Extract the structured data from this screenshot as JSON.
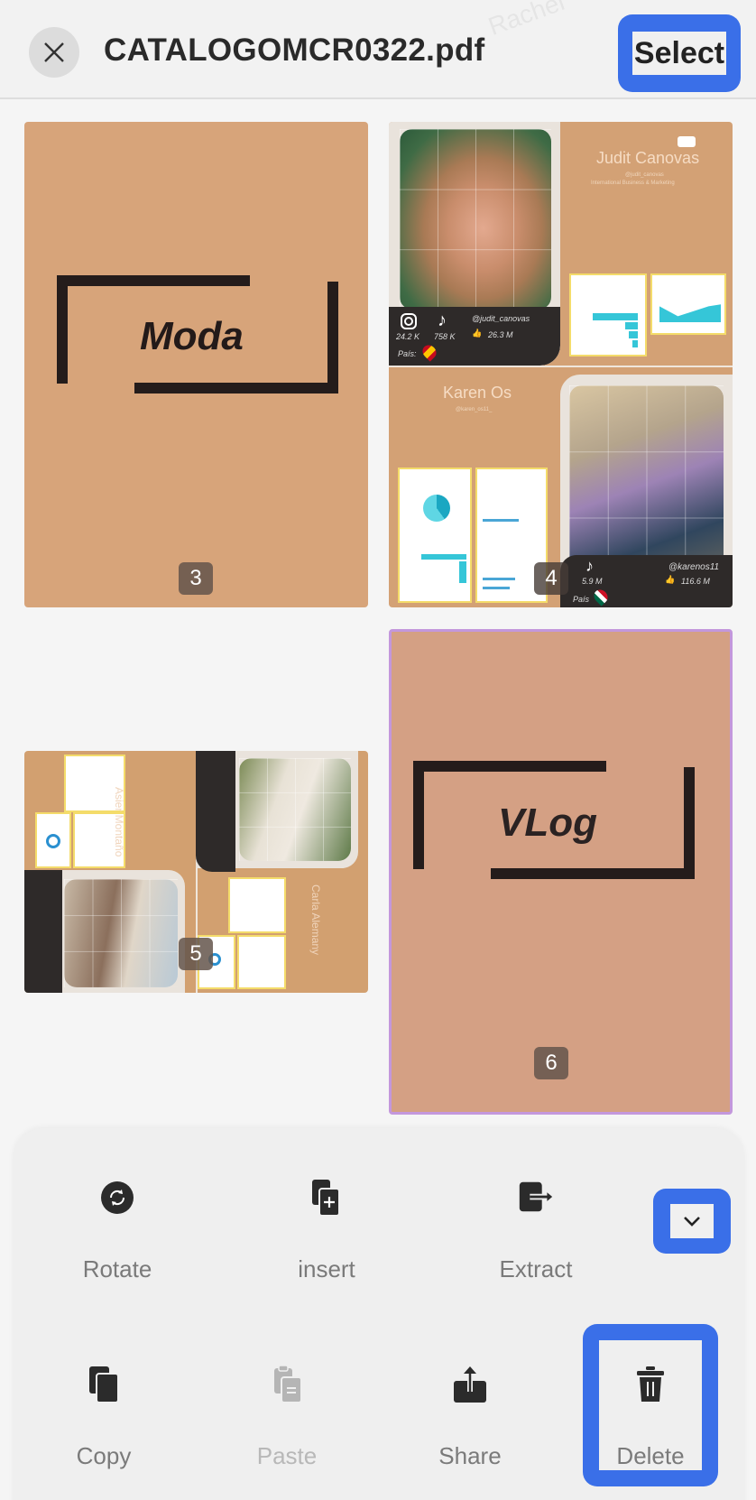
{
  "header": {
    "title": "CATALOGOMCR0322.pdf",
    "select_label": "Select"
  },
  "pages": [
    {
      "number": "3",
      "title": "Moda",
      "selected": false
    },
    {
      "number": "4",
      "selected": false,
      "profiles": [
        {
          "name": "Judit Canovas",
          "handle": "@judit_canovas",
          "subtitle": "International Business & Marketing",
          "instagram_followers": "24.2 K",
          "tiktok_followers": "758 K",
          "likes": "26.3 M",
          "country_label": "País:"
        },
        {
          "name": "Karen Os",
          "handle": "@karen_os11_",
          "tiktok_handle": "@karenos11",
          "tiktok_followers": "5.9 M",
          "likes": "116.6 M",
          "country_label": "País"
        }
      ]
    },
    {
      "number": "5",
      "selected": false,
      "profiles": [
        {
          "name": "Asier Montaño"
        },
        {
          "name": "Carla Alemany"
        }
      ]
    },
    {
      "number": "6",
      "title": "VLog",
      "selected": true
    }
  ],
  "toolbar": {
    "row1": [
      {
        "label": "Rotate",
        "icon": "rotate-icon",
        "enabled": true
      },
      {
        "label": "insert",
        "icon": "insert-page-icon",
        "enabled": true
      },
      {
        "label": "Extract",
        "icon": "extract-icon",
        "enabled": true
      }
    ],
    "row2": [
      {
        "label": "Copy",
        "icon": "copy-icon",
        "enabled": true
      },
      {
        "label": "Paste",
        "icon": "paste-icon",
        "enabled": false
      },
      {
        "label": "Share",
        "icon": "share-icon",
        "enabled": true
      },
      {
        "label": "Delete",
        "icon": "trash-icon",
        "enabled": true
      }
    ]
  },
  "colors": {
    "accent": "#3a6fe8",
    "selection_border": "#c397dc",
    "page_tan": "#d7a47a"
  }
}
